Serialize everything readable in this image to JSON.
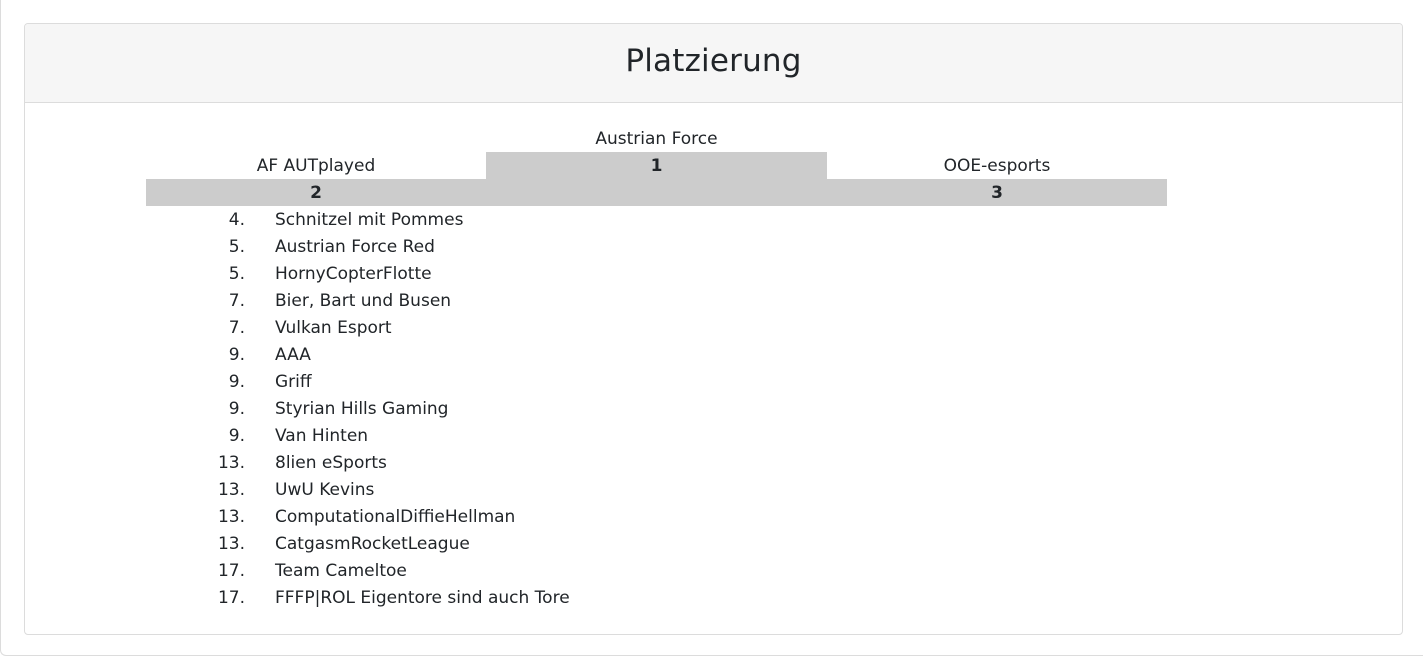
{
  "card": {
    "title": "Platzierung"
  },
  "podium": {
    "first": {
      "rank": "1",
      "team": "Austrian Force"
    },
    "second": {
      "rank": "2",
      "team": "AF AUTplayed"
    },
    "third": {
      "rank": "3",
      "team": "OOE-esports"
    }
  },
  "ranking": [
    {
      "rank": "4.",
      "team": "Schnitzel mit Pommes"
    },
    {
      "rank": "5.",
      "team": "Austrian Force Red"
    },
    {
      "rank": "5.",
      "team": "HornyCopterFlotte"
    },
    {
      "rank": "7.",
      "team": "Bier, Bart und Busen"
    },
    {
      "rank": "7.",
      "team": "Vulkan Esport"
    },
    {
      "rank": "9.",
      "team": "AAA"
    },
    {
      "rank": "9.",
      "team": "Griff"
    },
    {
      "rank": "9.",
      "team": "Styrian Hills Gaming"
    },
    {
      "rank": "9.",
      "team": "Van Hinten"
    },
    {
      "rank": "13.",
      "team": "8lien eSports"
    },
    {
      "rank": "13.",
      "team": "UwU Kevins"
    },
    {
      "rank": "13.",
      "team": "ComputationalDiffieHellman"
    },
    {
      "rank": "13.",
      "team": "CatgasmRocketLeague"
    },
    {
      "rank": "17.",
      "team": "Team Cameltoe"
    },
    {
      "rank": "17.",
      "team": "FFFP|ROL Eigentore sind auch Tore"
    }
  ],
  "colors": {
    "podium_block": "#cccccc",
    "header_background": "#f6f6f6",
    "border": "#dcdcdc",
    "text": "#212529"
  }
}
